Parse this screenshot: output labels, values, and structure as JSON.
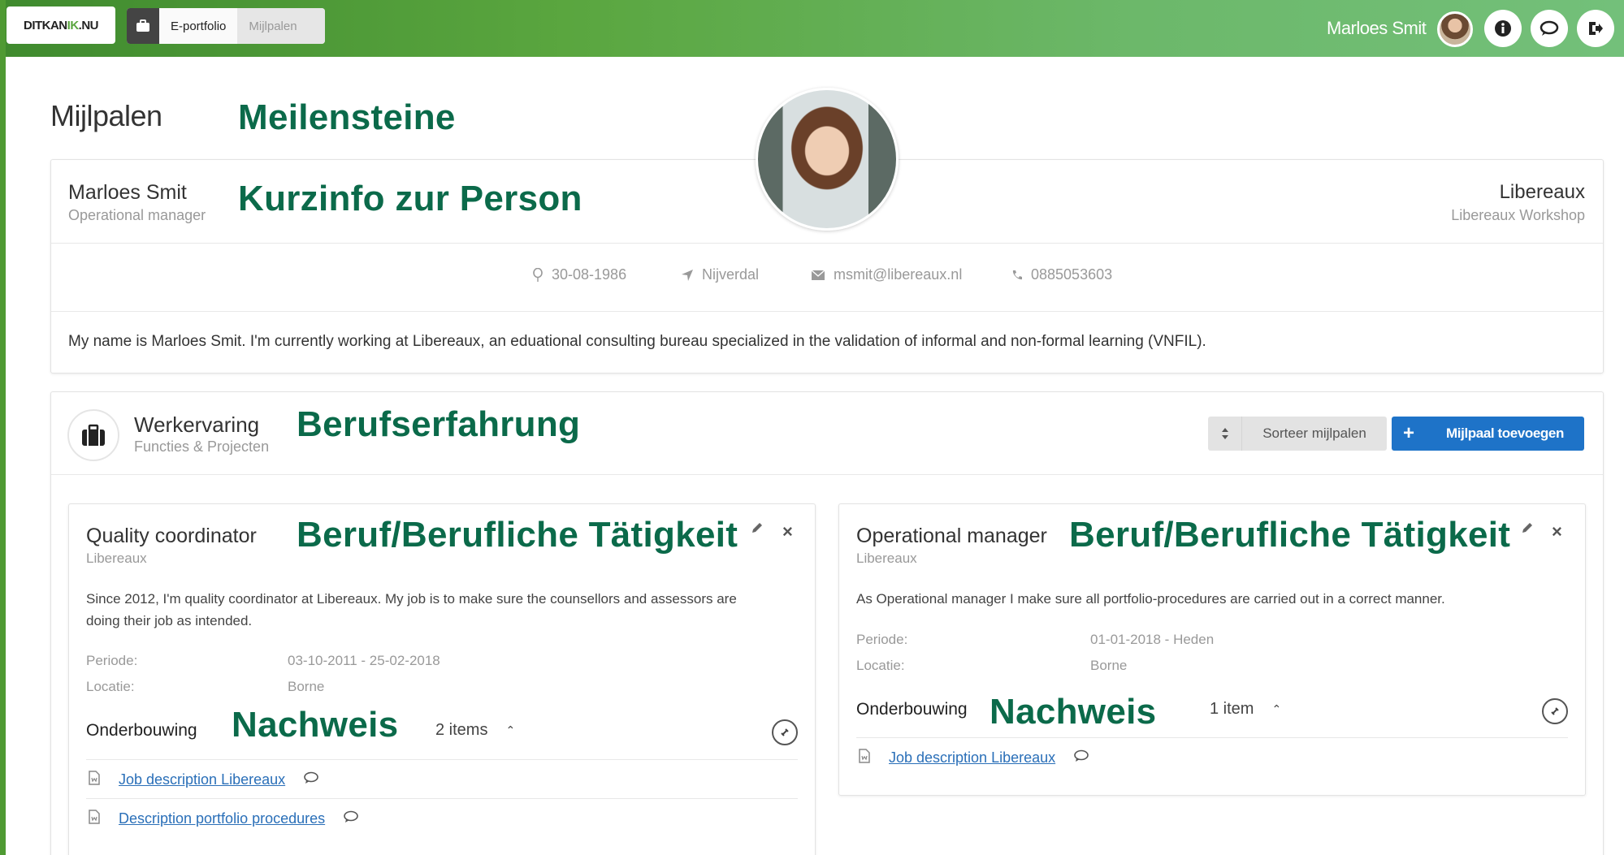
{
  "topbar": {
    "logo_text": "DITKANIK.NU",
    "logo_main": "DITKAN",
    "logo_highlight": "IK",
    "logo_tail": ".NU",
    "tabs": [
      {
        "label": "E-portfolio"
      },
      {
        "label": "Mijlpalen"
      }
    ],
    "user_name": "Marloes Smit",
    "icons": [
      "info-icon",
      "chat-icon",
      "logout-icon"
    ]
  },
  "page": {
    "title": "Mijlpalen"
  },
  "annotations": {
    "milestones": "Meilensteine",
    "person_info": "Kurzinfo zur Person",
    "work_experience": "Berufserfahrung",
    "job_1": "Beruf/Berufliche Tätigkeit",
    "job_2": "Beruf/Berufliche Tätigkeit",
    "evidence_1": "Nachweis",
    "evidence_2": "Nachweis"
  },
  "profile": {
    "name": "Marloes Smit",
    "role": "Operational manager",
    "org_name": "Libereaux",
    "org_sub": "Libereaux Workshop",
    "birthdate": "30-08-1986",
    "city": "Nijverdal",
    "email": "msmit@libereaux.nl",
    "phone": "0885053603",
    "bio": "My name is Marloes Smit. I'm currently working at Libereaux, an eduational consulting bureau specialized in the validation of informal and non-formal learning (VNFIL)."
  },
  "work_section": {
    "title": "Werkervaring",
    "subtitle": "Functies & Projecten",
    "sort_label": "Sorteer mijlpalen",
    "add_label": "Mijlpaal toevoegen"
  },
  "milestones": [
    {
      "title": "Quality coordinator",
      "company": "Libereaux",
      "description_line1": "Since 2012, I'm quality coordinator at Libereaux. My job is to make sure the counsellors and assessors are",
      "description_line2": "doing their job as intended.",
      "period_label": "Periode:",
      "period_value": "03-10-2011 - 25-02-2018",
      "location_label": "Locatie:",
      "location_value": "Borne",
      "evidence_label": "Onderbouwing",
      "evidence_count": "2 items",
      "documents": [
        {
          "label": "Job description Libereaux"
        },
        {
          "label": "Description portfolio procedures"
        }
      ]
    },
    {
      "title": "Operational manager",
      "company": "Libereaux",
      "description_line1": "As Operational manager I make sure all portfolio-procedures are carried out in a correct manner.",
      "period_label": "Periode:",
      "period_value": "01-01-2018 - Heden",
      "location_label": "Locatie:",
      "location_value": "Borne",
      "evidence_label": "Onderbouwing",
      "evidence_count": "1 item",
      "documents": [
        {
          "label": "Job description Libereaux"
        }
      ]
    }
  ],
  "colors": {
    "annotation": "#0b6a4a",
    "primary": "#1e73c8",
    "topbar_start": "#3f8a2e",
    "topbar_end": "#73c07a"
  }
}
